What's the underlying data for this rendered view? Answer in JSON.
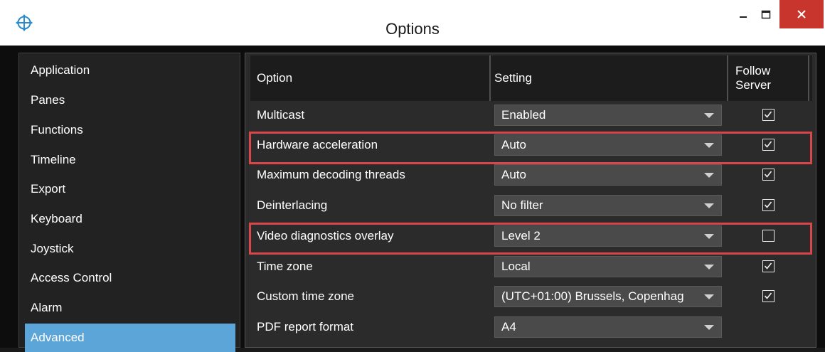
{
  "window": {
    "title": "Options"
  },
  "sidebar": {
    "items": [
      {
        "label": "Application"
      },
      {
        "label": "Panes"
      },
      {
        "label": "Functions"
      },
      {
        "label": "Timeline"
      },
      {
        "label": "Export"
      },
      {
        "label": "Keyboard"
      },
      {
        "label": "Joystick"
      },
      {
        "label": "Access Control"
      },
      {
        "label": "Alarm"
      },
      {
        "label": "Advanced",
        "selected": true
      }
    ]
  },
  "table": {
    "columns": {
      "option": "Option",
      "setting": "Setting",
      "follow_server_line1": "Follow",
      "follow_server_line2": "Server"
    },
    "rows": [
      {
        "option": "Multicast",
        "setting": "Enabled",
        "follow_server": true
      },
      {
        "option": "Hardware acceleration",
        "setting": "Auto",
        "follow_server": true,
        "highlighted": true
      },
      {
        "option": "Maximum decoding threads",
        "setting": "Auto",
        "follow_server": true
      },
      {
        "option": "Deinterlacing",
        "setting": "No filter",
        "follow_server": true
      },
      {
        "option": "Video diagnostics overlay",
        "setting": "Level 2",
        "follow_server": false,
        "highlighted": true
      },
      {
        "option": "Time zone",
        "setting": "Local",
        "follow_server": true
      },
      {
        "option": "Custom time zone",
        "setting": "(UTC+01:00) Brussels, Copenhag",
        "follow_server": true
      },
      {
        "option": "PDF report format",
        "setting": "A4",
        "follow_server": null
      }
    ]
  },
  "colors": {
    "highlight": "#d8454a",
    "selected_nav": "#5ca5d8",
    "close_button": "#c7352c"
  }
}
